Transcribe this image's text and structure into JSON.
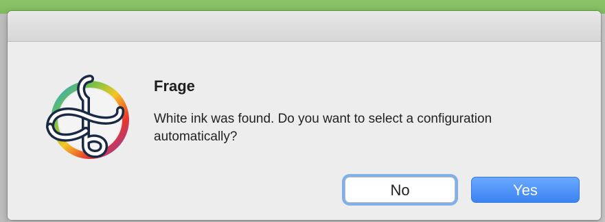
{
  "dialog": {
    "title": "Frage",
    "message": "White ink was found. Do you want to select a configuration automatically?",
    "app_icon": "colorful-ribbon-logo-icon"
  },
  "buttons": {
    "no_label": "No",
    "yes_label": "Yes"
  },
  "colors": {
    "default_button": "#3b83f2",
    "focus_ring": "#7fb0ea",
    "background_window": "#7fb95e"
  }
}
